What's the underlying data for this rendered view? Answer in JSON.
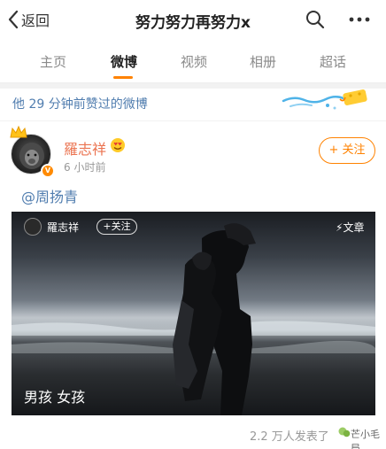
{
  "header": {
    "back_label": "返回",
    "title": "努力努力再努力x",
    "search_icon": "search-icon",
    "more_icon": "more-icon"
  },
  "tabs": [
    {
      "label": "主页",
      "active": false
    },
    {
      "label": "微博",
      "active": true
    },
    {
      "label": "视频",
      "active": false
    },
    {
      "label": "相册",
      "active": false
    },
    {
      "label": "超话",
      "active": false
    }
  ],
  "notice": {
    "text": "他 29 分钟前赞过的微博"
  },
  "post": {
    "username": "羅志祥",
    "emoji_icon": "smiling-face-with-heart-eyes-icon",
    "time": "6 小时前",
    "follow_label": "+ 关注",
    "mention": "@周扬青",
    "photo": {
      "username": "羅志祥",
      "follow_label": "+关注",
      "article_label": "文章",
      "caption": "男孩 女孩"
    },
    "footer_text": "2.2 万人发表了",
    "watermark_text": "芒小毛局"
  },
  "colors": {
    "accent": "#ff8200",
    "username": "#eb7350",
    "link": "#507daf"
  }
}
